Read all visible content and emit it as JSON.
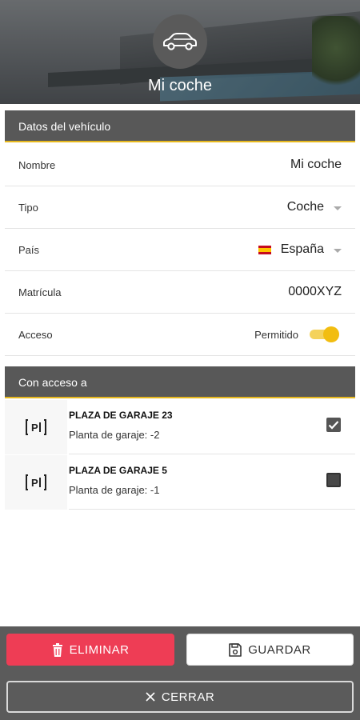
{
  "header": {
    "title": "Mi coche",
    "icon": "car-icon"
  },
  "vehicle_section": {
    "title": "Datos del vehículo",
    "rows": {
      "nombre": {
        "label": "Nombre",
        "value": "Mi coche"
      },
      "tipo": {
        "label": "Tipo",
        "value": "Coche"
      },
      "pais": {
        "label": "País",
        "value": "España",
        "flag": "spain-flag-icon"
      },
      "matricula": {
        "label": "Matrícula",
        "value": "0000XYZ"
      },
      "acceso": {
        "label": "Acceso",
        "value": "Permitido",
        "enabled": true
      }
    }
  },
  "access_section": {
    "title": "Con acceso a",
    "items": [
      {
        "name": "PLAZA DE GARAJE 23",
        "detail": "Planta de garaje: -2",
        "checked": true,
        "icon": "parking-icon"
      },
      {
        "name": "PLAZA DE GARAJE 5",
        "detail": "Planta de garaje: -1",
        "checked": false,
        "icon": "parking-icon"
      }
    ]
  },
  "footer": {
    "delete_label": "ELIMINAR",
    "save_label": "GUARDAR",
    "close_label": "CERRAR"
  },
  "colors": {
    "accent": "#e6b81e",
    "danger": "#ee3d55",
    "header_bg": "#585858",
    "footer_bg": "#5b5b5b",
    "toggle": "#f2bd10"
  }
}
